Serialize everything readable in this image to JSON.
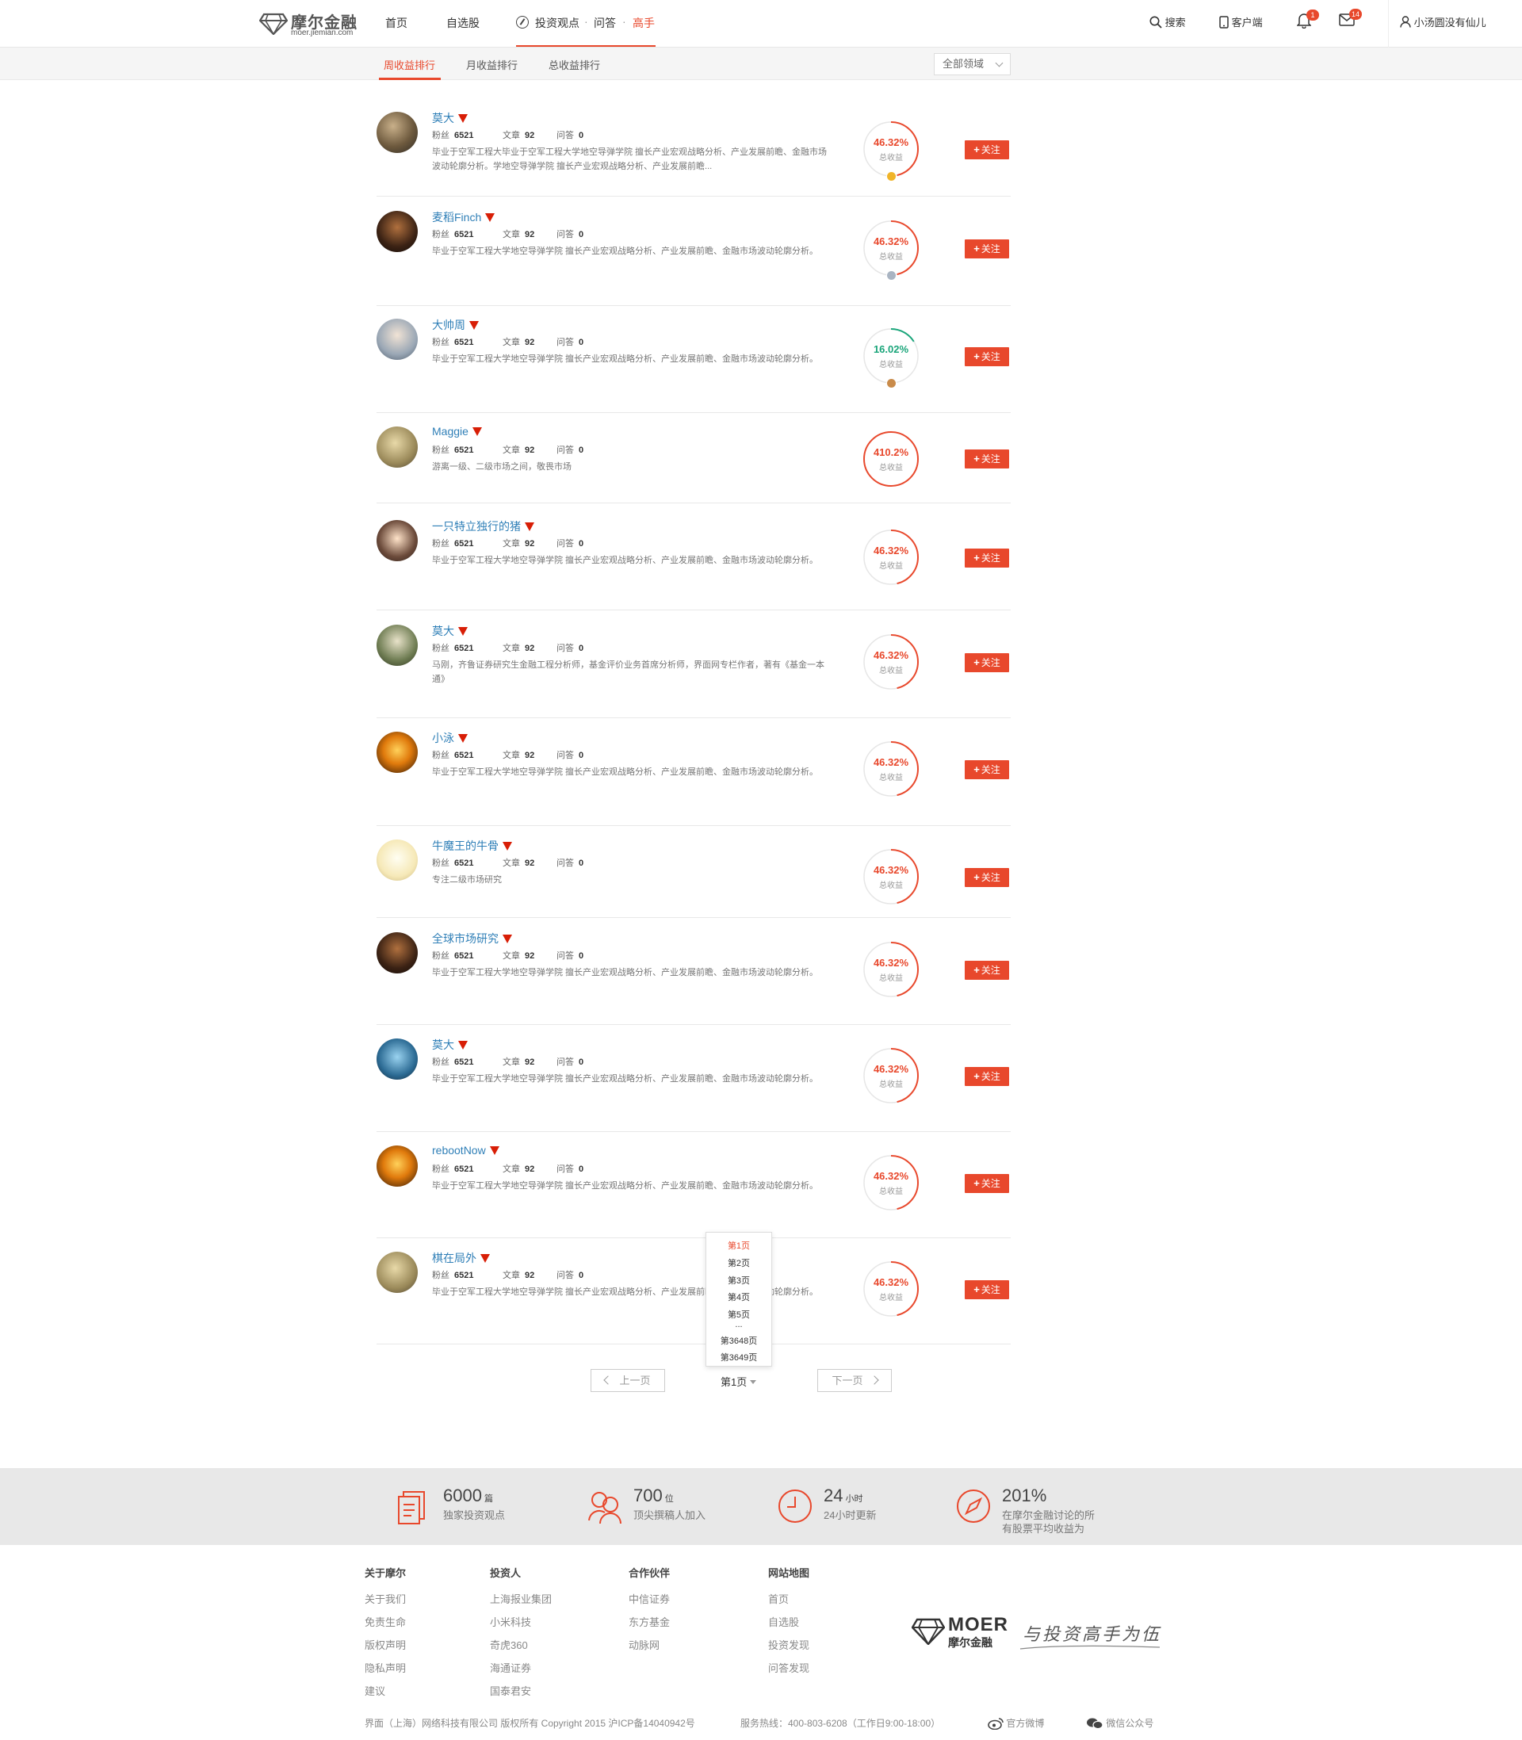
{
  "header": {
    "logo_title": "摩尔金融",
    "logo_domain": "moer.jiemian.com",
    "nav": [
      "首页",
      "自选股"
    ],
    "nav_group": {
      "a": "投资观点",
      "b": "问答",
      "c": "高手"
    },
    "search": "搜索",
    "client": "客户端",
    "notif_count": "1",
    "mail_count": "14",
    "username": "小汤圆没有仙儿"
  },
  "subnav": {
    "tabs": [
      "周收益排行",
      "月收益排行",
      "总收益排行"
    ],
    "domain_select": "全部领域"
  },
  "stat_labels": {
    "fans": "粉丝",
    "articles": "文章",
    "qa": "问答",
    "ring": "总收益",
    "follow": "关注"
  },
  "rows": [
    {
      "name": "莫大",
      "fans": "6521",
      "articles": "92",
      "qa": "0",
      "desc": "毕业于空军工程大毕业于空军工程大学地空导弹学院 擅长产业宏观战略分析、产业发展前瞻、金融市场波动轮廓分析。学地空导弹学院 擅长产业宏观战略分析、产业发展前瞻...",
      "value": "46.32%",
      "ratio": 0.4632,
      "color": "#e8482c",
      "medal": "#f0b429"
    },
    {
      "name": "麦稻Finch",
      "fans": "6521",
      "articles": "92",
      "qa": "0",
      "desc": "毕业于空军工程大学地空导弹学院 擅长产业宏观战略分析、产业发展前瞻、金融市场波动轮廓分析。",
      "value": "46.32%",
      "ratio": 0.4632,
      "color": "#e8482c",
      "medal": "#a9b4c2"
    },
    {
      "name": "大帅周",
      "fans": "6521",
      "articles": "92",
      "qa": "0",
      "desc": "毕业于空军工程大学地空导弹学院 擅长产业宏观战略分析、产业发展前瞻、金融市场波动轮廓分析。",
      "value": "16.02%",
      "ratio": 0.1602,
      "color": "#1aa57a",
      "medal": "#c98b4a"
    },
    {
      "name": "Maggie",
      "fans": "6521",
      "articles": "92",
      "qa": "0",
      "desc": "游离一级、二级市场之间，敬畏市场",
      "value": "410.2%",
      "ratio": 1.0,
      "color": "#e8482c",
      "medal": ""
    },
    {
      "name": "一只特立独行的猪",
      "fans": "6521",
      "articles": "92",
      "qa": "0",
      "desc": "毕业于空军工程大学地空导弹学院 擅长产业宏观战略分析、产业发展前瞻、金融市场波动轮廓分析。",
      "value": "46.32%",
      "ratio": 0.4632,
      "color": "#e8482c",
      "medal": ""
    },
    {
      "name": "莫大",
      "fans": "6521",
      "articles": "92",
      "qa": "0",
      "desc": "马刚，齐鲁证券研究生金融工程分析师，基金评价业务首席分析师，界面网专栏作者，著有《基金一本通》",
      "value": "46.32%",
      "ratio": 0.4632,
      "color": "#e8482c",
      "medal": ""
    },
    {
      "name": "小泳",
      "fans": "6521",
      "articles": "92",
      "qa": "0",
      "desc": "毕业于空军工程大学地空导弹学院 擅长产业宏观战略分析、产业发展前瞻、金融市场波动轮廓分析。",
      "value": "46.32%",
      "ratio": 0.4632,
      "color": "#e8482c",
      "medal": ""
    },
    {
      "name": "牛魔王的牛骨",
      "fans": "6521",
      "articles": "92",
      "qa": "0",
      "desc": "专注二级市场研究",
      "value": "46.32%",
      "ratio": 0.4632,
      "color": "#e8482c",
      "medal": ""
    },
    {
      "name": "全球市场研究",
      "fans": "6521",
      "articles": "92",
      "qa": "0",
      "desc": "毕业于空军工程大学地空导弹学院 擅长产业宏观战略分析、产业发展前瞻、金融市场波动轮廓分析。",
      "value": "46.32%",
      "ratio": 0.4632,
      "color": "#e8482c",
      "medal": ""
    },
    {
      "name": "莫大",
      "fans": "6521",
      "articles": "92",
      "qa": "0",
      "desc": "毕业于空军工程大学地空导弹学院 擅长产业宏观战略分析、产业发展前瞻、金融市场波动轮廓分析。",
      "value": "46.32%",
      "ratio": 0.4632,
      "color": "#e8482c",
      "medal": ""
    },
    {
      "name": "rebootNow",
      "fans": "6521",
      "articles": "92",
      "qa": "0",
      "desc": "毕业于空军工程大学地空导弹学院 擅长产业宏观战略分析、产业发展前瞻、金融市场波动轮廓分析。",
      "value": "46.32%",
      "ratio": 0.4632,
      "color": "#e8482c",
      "medal": ""
    },
    {
      "name": "棋在局外",
      "fans": "6521",
      "articles": "92",
      "qa": "0",
      "desc": "毕业于空军工程大学地空导弹学院 擅长产业宏观战略分析、产业发展前瞻、金融市场波动轮廓分析。",
      "value": "46.32%",
      "ratio": 0.4632,
      "color": "#e8482c",
      "medal": ""
    }
  ],
  "pagination": {
    "prev": "上一页",
    "next": "下一页",
    "current": "第1页",
    "options": [
      "第1页",
      "第2页",
      "第3页",
      "第4页",
      "第5页",
      "...",
      "第3648页",
      "第3649页"
    ]
  },
  "band": [
    {
      "num": "6000",
      "unit": "篇",
      "text": "独家投资观点",
      "text2": ""
    },
    {
      "num": "700",
      "unit": "位",
      "text": "顶尖撰稿人加入",
      "text2": ""
    },
    {
      "num": "24",
      "unit": "小时",
      "text": "24小时更新",
      "text2": ""
    },
    {
      "num": "201%",
      "unit": "",
      "text": "在摩尔金融讨论的所",
      "text2": "有股票平均收益为"
    }
  ],
  "footer": {
    "cols": [
      {
        "title": "关于摩尔",
        "links": [
          "关于我们",
          "免责生命",
          "版权声明",
          "隐私声明",
          "建议"
        ]
      },
      {
        "title": "投资人",
        "links": [
          "上海报业集团",
          "小米科技",
          "奇虎360",
          "海通证券",
          "国泰君安"
        ]
      },
      {
        "title": "合作伙伴",
        "links": [
          "中信证券",
          "东方基金",
          "动脉网"
        ]
      },
      {
        "title": "网站地图",
        "links": [
          "首页",
          "自选股",
          "投资发现",
          "问答发现"
        ]
      }
    ],
    "logo_en": "MOER",
    "logo_cn": "摩尔金融",
    "slogan": "与投资高手为伍",
    "copyright": "界面（上海）网络科技有限公司 版权所有 Copyright 2015 沪ICP备14040942号",
    "hotline": "服务热线：400-803-6208（工作日9:00-18:00）",
    "weibo": "官方微博",
    "wechat": "微信公众号"
  }
}
